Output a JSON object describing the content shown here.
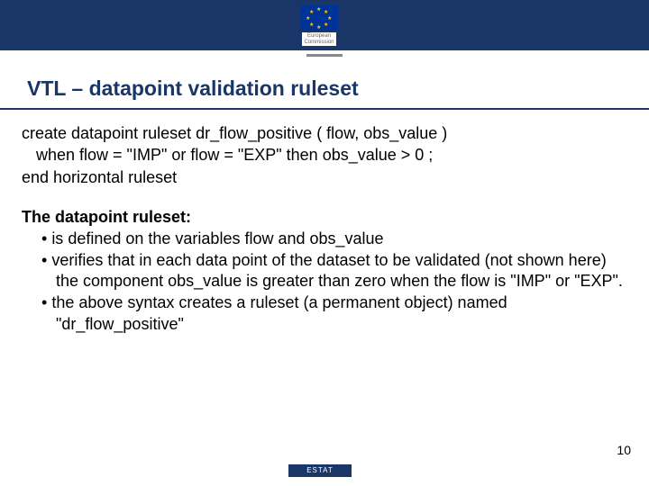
{
  "header": {
    "logo_line1": "European",
    "logo_line2": "Commission"
  },
  "title": "VTL – datapoint validation ruleset",
  "code": {
    "line1": "create datapoint ruleset dr_flow_positive ( flow, obs_value )",
    "line2": "when flow = \"IMP\" or flow = \"EXP\" then obs_value > 0 ;",
    "line3": "end horizontal ruleset"
  },
  "desc_heading": "The datapoint ruleset:",
  "bullets": [
    "is defined on the variables flow and obs_value",
    "verifies that in each data point of the dataset to be validated (not shown here) the component obs_value is greater than zero when the flow is \"IMP\" or \"EXP\".",
    "the above syntax creates a ruleset (a permanent object) named \"dr_flow_positive\""
  ],
  "page_number": "10",
  "footer_label": "ESTAT"
}
